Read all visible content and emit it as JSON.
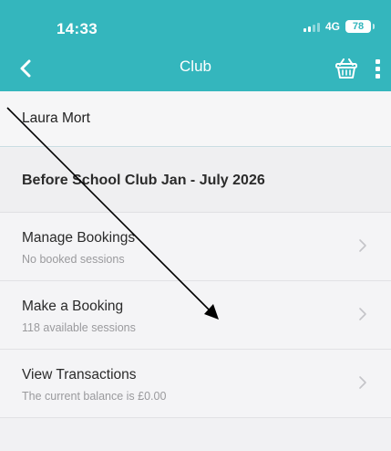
{
  "status_bar": {
    "time": "14:33",
    "network": "4G",
    "battery": "78"
  },
  "nav": {
    "title": "Club"
  },
  "child_name": "Laura Mort",
  "club_name": "Before School Club Jan - July 2026",
  "menu": [
    {
      "title": "Manage Bookings",
      "subtitle": "No booked sessions"
    },
    {
      "title": "Make a Booking",
      "subtitle": "118 available sessions"
    },
    {
      "title": "View Transactions",
      "subtitle": "The current balance is £0.00"
    }
  ],
  "colors": {
    "header": "#34b6bd",
    "background": "#f1f1f3",
    "annotation_line": "#000000"
  },
  "icons": [
    "back-chevron-icon",
    "basket-icon",
    "more-vertical-icon",
    "chevron-right-icon",
    "signal-icon",
    "battery-icon"
  ]
}
